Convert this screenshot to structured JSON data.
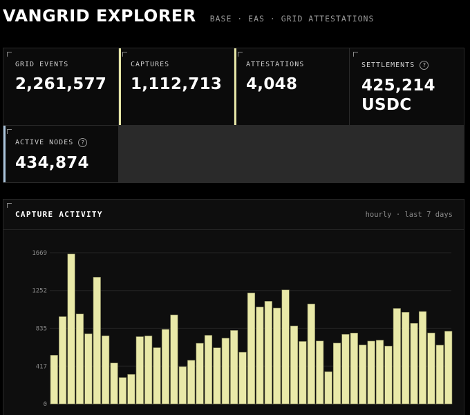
{
  "app": {
    "title": "VANGRID EXPLORER",
    "subtitle": "BASE · EAS · GRID ATTESTATIONS"
  },
  "colors": {
    "accent_yellow": "#e6e6a6",
    "accent_blue": "#a9c4db",
    "bar_fill": "#e9e9a8",
    "bar_stroke": "#7e7e55"
  },
  "stats": [
    {
      "label": "GRID EVENTS",
      "value": "2,261,577",
      "help": false,
      "accent": "none"
    },
    {
      "label": "CAPTURES",
      "value": "1,112,713",
      "help": false,
      "accent": "yellow"
    },
    {
      "label": "ATTESTATIONS",
      "value": "4,048",
      "help": false,
      "accent": "yellow"
    },
    {
      "label": "SETTLEMENTS",
      "value": "425,214",
      "unit": "USDC",
      "help": true,
      "help_icon": "question-circle-icon",
      "accent": "none"
    },
    {
      "label": "ACTIVE NODES",
      "value": "434,874",
      "help": true,
      "help_icon": "question-circle-icon",
      "accent": "blue"
    }
  ],
  "activity": {
    "title": "CAPTURE ACTIVITY",
    "caption": "hourly · last 7 days"
  },
  "chart_data": {
    "type": "bar",
    "title": "CAPTURE ACTIVITY",
    "xlabel": "",
    "ylabel": "",
    "ylim": [
      0,
      1669
    ],
    "y_ticks": [
      "0",
      "417",
      "835",
      "1252",
      "1669"
    ],
    "grid": true,
    "values": [
      538,
      964,
      1655,
      993,
      774,
      1399,
      752,
      452,
      292,
      326,
      743,
      751,
      621,
      823,
      983,
      412,
      482,
      670,
      758,
      620,
      726,
      812,
      571,
      1226,
      1070,
      1133,
      1059,
      1259,
      861,
      690,
      1104,
      695,
      356,
      672,
      768,
      783,
      651,
      694,
      704,
      639,
      1055,
      1012,
      890,
      1020,
      784,
      649,
      803
    ]
  }
}
